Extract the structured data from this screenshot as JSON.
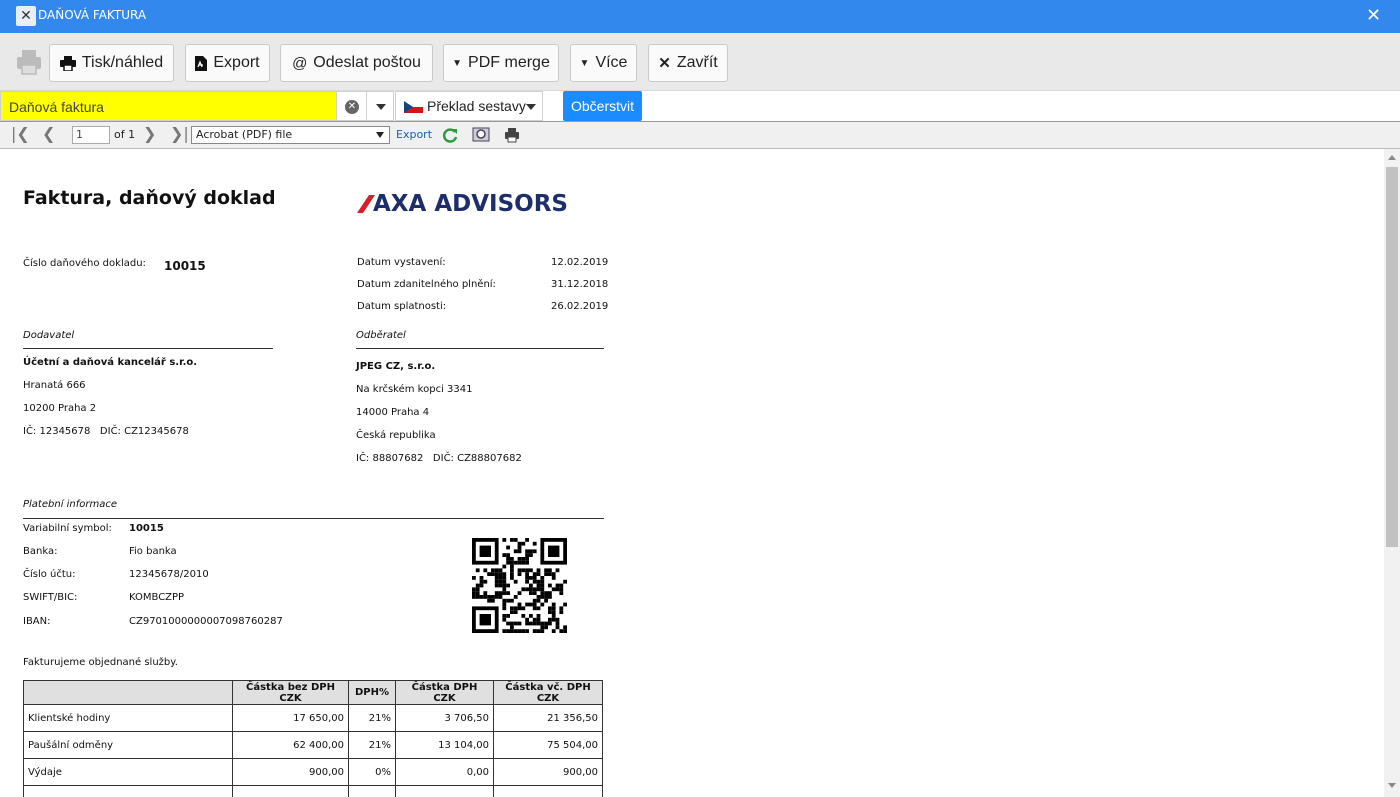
{
  "window": {
    "title": "DAŇOVÁ FAKTURA"
  },
  "toolbar": {
    "print_preview": "Tisk/náhled",
    "export": "Export",
    "send_mail": "Odeslat poštou",
    "pdf_merge": "PDF merge",
    "more": "Více",
    "close": "Zavřít"
  },
  "selector": {
    "report_value": "Daňová faktura",
    "language_label": "Překlad sestavy",
    "refresh": "Občerstvit"
  },
  "viewer": {
    "page": "1",
    "of": "of 1",
    "format": "Acrobat (PDF) file",
    "export": "Export"
  },
  "invoice": {
    "title": "Faktura, daňový doklad",
    "logo_text": "AXA ADVISORS",
    "number_label": "Číslo daňového dokladu:",
    "number": "10015",
    "dates": [
      {
        "label": "Datum vystavení:",
        "value": "12.02.2019"
      },
      {
        "label": "Datum zdanitelného plnění:",
        "value": "31.12.2018"
      },
      {
        "label": "Datum splatnosti:",
        "value": "26.02.2019"
      }
    ],
    "supplier": {
      "heading": "Dodavatel",
      "name": "Účetní a daňová kancelář s.r.o.",
      "street": "Hranatá 666",
      "city": "10200 Praha 2",
      "ids": "IČ: 12345678   DIČ: CZ12345678"
    },
    "customer": {
      "heading": "Odběratel",
      "name": "JPEG CZ, s.r.o.",
      "street": "Na krčském kopci 3341",
      "city": "14000 Praha 4",
      "country": "Česká republika",
      "ids": "IČ: 88807682   DIČ: CZ88807682"
    },
    "payment": {
      "heading": "Platební informace",
      "rows": [
        {
          "label": "Variabilní symbol:",
          "value": "10015"
        },
        {
          "label": "Banka:",
          "value": "Fio banka"
        },
        {
          "label": "Číslo účtu:",
          "value": "12345678/2010"
        },
        {
          "label": "SWIFT/BIC:",
          "value": "KOMBCZPP"
        },
        {
          "label": "IBAN:",
          "value": "CZ9701000000007098760287"
        }
      ]
    },
    "intro": "Fakturujeme objednané služby.",
    "table": {
      "headers": [
        "",
        "Částka bez DPH CZK",
        "DPH%",
        "Částka DPH CZK",
        "Částka vč. DPH CZK"
      ],
      "rows": [
        [
          "Klientské hodiny",
          "17 650,00",
          "21%",
          "3 706,50",
          "21 356,50"
        ],
        [
          "Paušální odměny",
          "62 400,00",
          "21%",
          "13 104,00",
          "75 504,00"
        ],
        [
          "Výdaje",
          "900,00",
          "0%",
          "0,00",
          "900,00"
        ]
      ]
    }
  }
}
